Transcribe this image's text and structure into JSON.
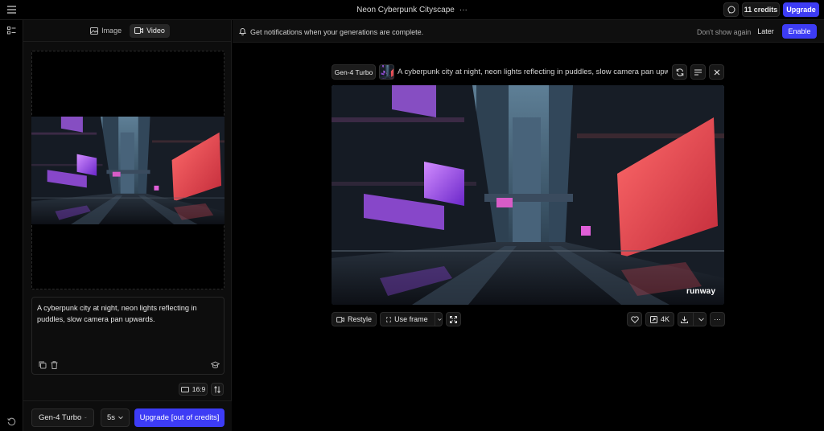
{
  "header": {
    "title": "Neon Cyberpunk Cityscape",
    "more_icon": "ellipsis-icon",
    "credits_label": "11 credits",
    "upgrade_label": "Upgrade"
  },
  "panel": {
    "tabs": [
      {
        "label": "Image",
        "icon": "image-icon"
      },
      {
        "label": "Video",
        "icon": "video-icon",
        "active": true
      }
    ],
    "prompt": "A cyberpunk city at night, neon lights reflecting in puddles, slow camera pan upwards.",
    "aspect_ratio": "16:9",
    "model": "Gen-4 Turbo",
    "duration": "5s",
    "generate_label": "Upgrade [out of credits]"
  },
  "notification": {
    "message": "Get notifications when your generations are complete.",
    "dismiss_label": "Don't show again",
    "later_label": "Later",
    "enable_label": "Enable"
  },
  "result": {
    "model_badge": "Gen-4 Turbo",
    "prompt_excerpt": "A cyberpunk city at night, neon lights reflecting in puddles, slow camera pan upw...",
    "watermark": "runway",
    "actions": {
      "restyle": "Restyle",
      "use_frame": "Use frame",
      "upscale": "4K"
    }
  },
  "colors": {
    "accent": "#3d3cf5",
    "background": "#000000",
    "panel": "#0d0d0d"
  }
}
